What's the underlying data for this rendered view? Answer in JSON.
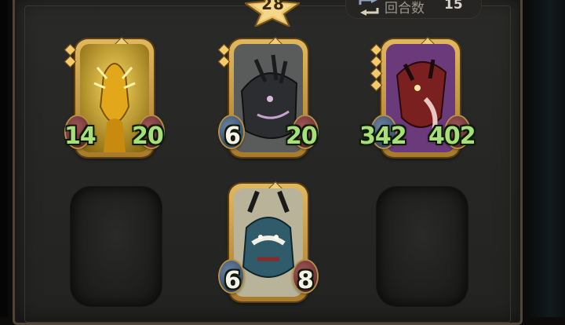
{
  "turn": {
    "value": "28"
  },
  "round_counter": {
    "label": "回合数",
    "value": "15"
  },
  "colors": {
    "attack_green": "#a7e07a",
    "stat_white": "#f6f2ea",
    "gold_frame": "#e2b85e"
  },
  "board": {
    "cards": [
      {
        "id": "golden-dragon",
        "attack": "14",
        "health": "20",
        "attack_color": "green",
        "health_color": "green",
        "pips": 2
      },
      {
        "id": "grey-dragon",
        "attack": "6",
        "health": "20",
        "attack_color": "white",
        "health_color": "green",
        "pips": 2
      },
      {
        "id": "crimson-serpent",
        "attack": "342",
        "health": "402",
        "attack_color": "green",
        "health_color": "green",
        "pips": 4
      },
      {
        "id": "horned-demon",
        "attack": "6",
        "health": "8",
        "attack_color": "white",
        "health_color": "white",
        "pips": 0
      }
    ],
    "empty_slots": 2
  }
}
